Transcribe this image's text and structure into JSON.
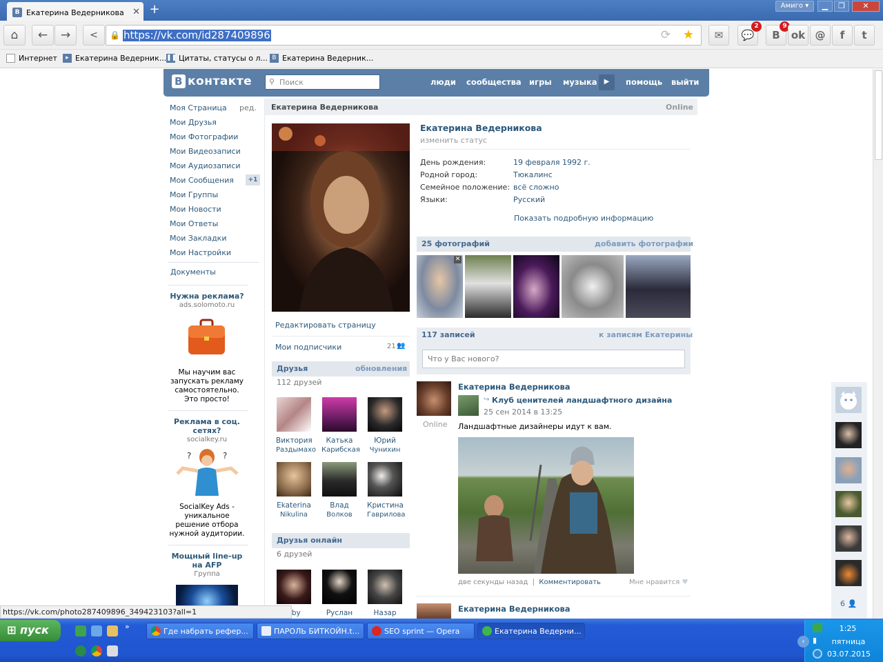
{
  "browser": {
    "tab_title": "Екатерина Ведерникова",
    "tab_favicon": "В",
    "new_tab": "+",
    "amigo_label": "Амиго ▾",
    "url": "https://vk.com/id287409896",
    "badges": {
      "messages": "2",
      "vk": "9"
    },
    "bookmarks": [
      "Интернет",
      "Екатерина Ведерник...",
      "Цитаты, статусы о л...",
      "Екатерина Ведерник..."
    ]
  },
  "vk": {
    "logo": "контакте",
    "search_placeholder": "Поиск",
    "nav": [
      "люди",
      "сообщества",
      "игры",
      "музыка",
      "помощь",
      "выйти"
    ],
    "menu": [
      "Моя Страница",
      "Мои Друзья",
      "Мои Фотографии",
      "Мои Видеозаписи",
      "Мои Аудиозаписи",
      "Мои Сообщения",
      "Мои Группы",
      "Мои Новости",
      "Мои Ответы",
      "Мои Закладки",
      "Мои Настройки"
    ],
    "menu_edit": "ред.",
    "messages_badge": "+1",
    "documents": "Документы",
    "ads": [
      {
        "title": "Нужна реклама?",
        "sub": "ads.solomoto.ru",
        "text": "Мы научим вас запускать рекламу самостоятельно. Это просто!"
      },
      {
        "title": "Реклама в соц. сетях?",
        "sub": "socialkey.ru",
        "text": "SocialKey Ads - уникальное решение отбора нужной аудитории."
      },
      {
        "title": "Мощный line-up на AFP",
        "sub": "Группа"
      }
    ],
    "profile": {
      "top_name": "Екатерина Ведерникова",
      "online": "Online",
      "name": "Екатерина Ведерникова",
      "status": "изменить статус",
      "info": [
        {
          "label": "День рождения:",
          "value": "19 февраля 1992 г."
        },
        {
          "label": "Родной город:",
          "value": "Тюкалинс"
        },
        {
          "label": "Семейное положение:",
          "value": "всё сложно"
        },
        {
          "label": "Языки:",
          "value": "Русский"
        }
      ],
      "more_info": "Показать подробную информацию",
      "edit_page": "Редактировать страницу",
      "followers_label": "Мои подписчики",
      "followers_count": "21"
    },
    "friends": {
      "title": "Друзья",
      "updates": "обновления",
      "count": "112 друзей",
      "list": [
        {
          "first": "Виктория",
          "last": "Раздымахо"
        },
        {
          "first": "Катька",
          "last": "Карибская"
        },
        {
          "first": "Юрий",
          "last": "Чунихин"
        },
        {
          "first": "Ekaterina",
          "last": "Nikulina"
        },
        {
          "first": "Влад",
          "last": "Волков"
        },
        {
          "first": "Кристина",
          "last": "Гаврилова"
        }
      ]
    },
    "friends_online": {
      "title": "Друзья онлайн",
      "count": "6 друзей",
      "list": [
        "uby",
        "Руслан",
        "Назар"
      ]
    },
    "photos": {
      "title": "25 фотографий",
      "add": "добавить фотографии"
    },
    "wall": {
      "title": "117 записей",
      "link": "к записям Екатерины",
      "placeholder": "Что у Вас нового?",
      "post": {
        "author": "Екатерина Ведерникова",
        "online": "Online",
        "group": "Клуб ценителей ландшафтного дизайна",
        "date": "25 сен 2014 в 13:25",
        "text": "Ландшафтные дизайнеры идут к вам.",
        "time_ago": "две секунды назад",
        "comment": "Комментировать",
        "like": "Мне нравится"
      },
      "next_author": "Екатерина Ведерникова"
    },
    "rail_count": "6"
  },
  "status_url": "https://vk.com/photo287409896_349423103?all=1",
  "taskbar": {
    "start": "пуск",
    "tasks": [
      "Где набрать рефер...",
      "ПАРОЛЬ БИТКОЙН.t...",
      "SEO sprint — Opera",
      "Екатерина Ведерни..."
    ],
    "time": "1:25",
    "day": "пятница",
    "date": "03.07.2015"
  }
}
